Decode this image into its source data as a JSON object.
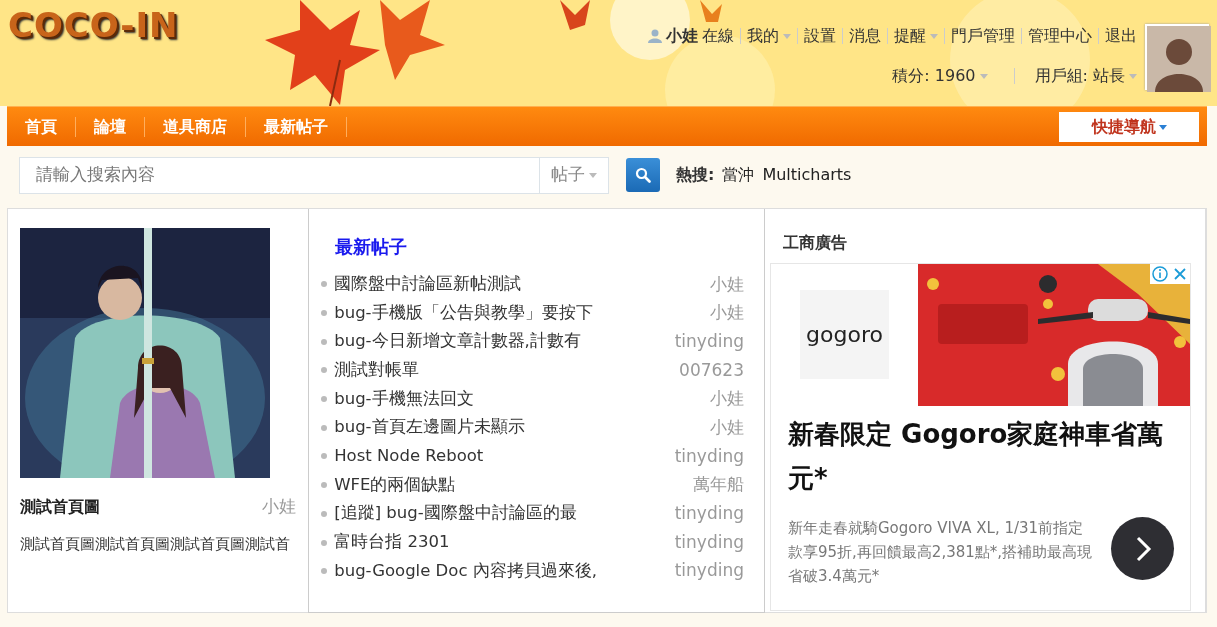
{
  "header": {
    "logo": "COCO-IN",
    "user": {
      "name": "小娃",
      "status": "在線"
    },
    "user_menu": [
      {
        "label": "我的",
        "dropdown": true
      },
      {
        "label": "設置",
        "dropdown": false
      },
      {
        "label": "消息",
        "dropdown": false
      },
      {
        "label": "提醒",
        "dropdown": true
      },
      {
        "label": "門戶管理",
        "dropdown": false
      },
      {
        "label": "管理中心",
        "dropdown": false
      },
      {
        "label": "退出",
        "dropdown": false
      }
    ],
    "stats": [
      {
        "label": "積分: 1960",
        "dropdown": true
      },
      {
        "label": "用戶組: 站長",
        "dropdown": true
      }
    ]
  },
  "nav": {
    "items": [
      {
        "label": "首頁"
      },
      {
        "label": "論壇"
      },
      {
        "label": "道具商店"
      },
      {
        "label": "最新帖子"
      }
    ],
    "quick_nav": "快捷導航"
  },
  "search": {
    "placeholder": "請輸入搜索內容",
    "scope": "帖子",
    "hot_label": "熱搜:",
    "hot_terms": [
      "當沖",
      "Multicharts"
    ]
  },
  "featured": {
    "kind": "picture",
    "title": "測試首頁圖",
    "author": "小娃",
    "summary": "測試首頁圖測試首頁圖測試首頁圖測試首"
  },
  "latest": {
    "title": "最新帖子",
    "posts": [
      {
        "title": "國際盤中討論區新帖測試",
        "author": "小娃"
      },
      {
        "title": "bug-手機版「公告與教學」要按下",
        "author": "小娃"
      },
      {
        "title": "bug-今日新增文章計數器,計數有",
        "author": "tinyding"
      },
      {
        "title": "測試對帳單",
        "author": "007623"
      },
      {
        "title": "bug-手機無法回文",
        "author": "小娃"
      },
      {
        "title": "bug-首頁左邊圖片未顯示",
        "author": "小娃"
      },
      {
        "title": "Host Node Reboot",
        "author": "tinyding"
      },
      {
        "title": "WFE的兩個缺點",
        "author": "萬年船"
      },
      {
        "title": "[追蹤] bug-國際盤中討論區的最",
        "author": "tinyding"
      },
      {
        "title": "富時台指 2301",
        "author": "tinyding"
      },
      {
        "title": "bug-Google Doc 內容拷貝過來後,",
        "author": "tinyding"
      }
    ]
  },
  "ad": {
    "heading": "工商廣告",
    "logo": "gogoro",
    "headline": "新春限定 Gogoro家庭神車省萬元*",
    "body": "新年走春就騎Gogoro VIVA XL, 1/31前指定款享95折,再回饋最高2,381點*,搭補助最高現省破3.4萬元*"
  }
}
